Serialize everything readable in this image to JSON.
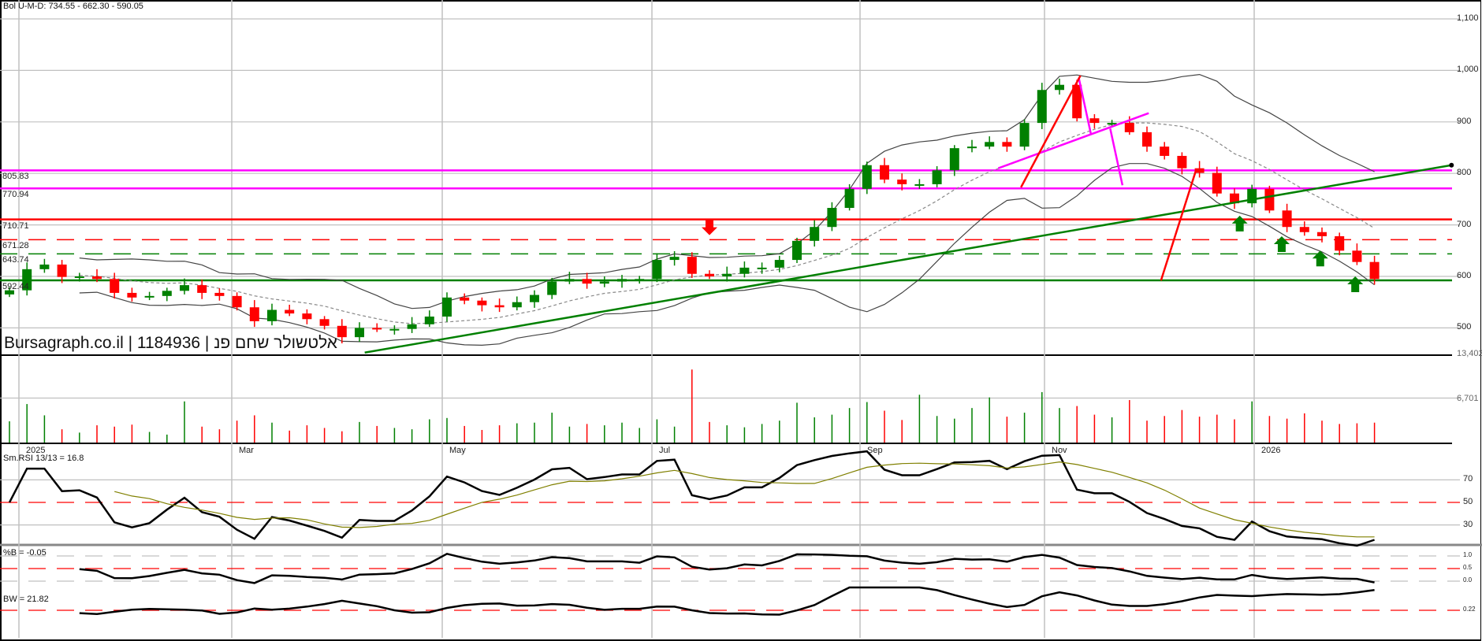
{
  "header": {
    "bollinger_readout": "Bol U-M-D: 734.55 - 662.30 - 590.05",
    "watermark": "Bursagraph.co.il | 1184936 | אלטשולר שחם פנ"
  },
  "indicators": {
    "rsi_label": "Sm.RSI 13/13 = 16.8",
    "pctb_label": "%B = -0.05",
    "bw_label": "BW = 21.82"
  },
  "colors": {
    "up": "#008000",
    "down": "#ff0000",
    "magenta": "#ff00ff",
    "band": "#444444",
    "grid": "#c0c0c0"
  },
  "chart_data": {
    "type": "candlestick",
    "title": "Bursagraph.co.il | 1184936 | אלטשולר שחם פנ",
    "x_tick_labels": [
      "2025",
      "Mar",
      "May",
      "Jul",
      "Sep",
      "Nov",
      "2026"
    ],
    "price_ticks": [
      {
        "value": 1100,
        "label": "1,100"
      },
      {
        "value": 1000,
        "label": "1,000"
      },
      {
        "value": 900,
        "label": "900"
      },
      {
        "value": 800,
        "label": "800"
      },
      {
        "value": 700,
        "label": "700"
      },
      {
        "value": 600,
        "label": "600"
      },
      {
        "value": 500,
        "label": "500"
      }
    ],
    "ylim": [
      430,
      1135
    ],
    "closes": [
      573,
      614,
      623,
      599,
      600,
      595,
      568,
      559,
      562,
      572,
      583,
      568,
      562,
      540,
      513,
      535,
      528,
      517,
      504,
      482,
      500,
      498,
      498,
      507,
      522,
      559,
      553,
      544,
      540,
      550,
      564,
      590,
      595,
      586,
      590,
      595,
      595,
      632,
      638,
      605,
      600,
      605,
      617,
      617,
      632,
      669,
      696,
      733,
      770,
      816,
      788,
      779,
      779,
      806,
      849,
      852,
      861,
      852,
      898,
      962,
      972,
      907,
      898,
      898,
      880,
      852,
      834,
      810,
      801,
      761,
      742,
      770,
      728,
      696,
      686,
      678,
      650,
      628,
      595
    ],
    "volume": [
      3200,
      5800,
      4100,
      2000,
      1500,
      2600,
      2400,
      2700,
      1600,
      1200,
      6200,
      2400,
      2000,
      3300,
      4100,
      3000,
      1800,
      2600,
      2200,
      1700,
      3100,
      2500,
      2200,
      2000,
      3500,
      3700,
      2500,
      1900,
      2600,
      2900,
      3000,
      4500,
      2400,
      2800,
      2600,
      3000,
      2200,
      3500,
      2400,
      11000,
      3100,
      2600,
      2300,
      2800,
      3300,
      6000,
      3800,
      4200,
      5200,
      6100,
      4800,
      3400,
      7200,
      4000,
      3600,
      5200,
      6800,
      3900,
      4500,
      7600,
      5200,
      5500,
      4200,
      3800,
      6400,
      3300,
      4000,
      4900,
      3900,
      4200,
      3500,
      6200,
      4000,
      3600,
      4400,
      3300,
      2800,
      2900,
      3000
    ],
    "volume_ticks": [
      {
        "value": 13402,
        "label": "13,402"
      },
      {
        "value": 6701,
        "label": "6,701"
      }
    ],
    "levels": [
      {
        "price": 805.83,
        "label": "805.83",
        "color": "#ff00ff",
        "style": "solid"
      },
      {
        "price": 770.94,
        "label": "770.94",
        "color": "#ff00ff",
        "style": "solid"
      },
      {
        "price": 710.71,
        "label": "710.71",
        "color": "#ff0000",
        "style": "solid"
      },
      {
        "price": 671.28,
        "label": "671.28",
        "color": "#ff0000",
        "style": "dashed"
      },
      {
        "price": 643.74,
        "label": "643.74",
        "color": "#008000",
        "style": "dashed"
      },
      {
        "price": 592.44,
        "label": "592.44",
        "color": "#008000",
        "style": "solid"
      }
    ],
    "trendlines": [
      {
        "name": "green-uptrend",
        "from": [
          20.3,
          452
        ],
        "to": [
          82.4,
          816
        ],
        "color": "#008000"
      },
      {
        "name": "magenta-neckline",
        "from": [
          56.5,
          810
        ],
        "to": [
          65.1,
          917
        ],
        "color": "#ff00ff"
      },
      {
        "name": "magenta-drop-1",
        "from": [
          61.1,
          986
        ],
        "to": [
          61.8,
          876
        ],
        "color": "#ff00ff"
      },
      {
        "name": "magenta-drop-2",
        "from": [
          62.9,
          887
        ],
        "to": [
          63.6,
          777
        ],
        "color": "#ff00ff"
      },
      {
        "name": "red-rise-1",
        "from": [
          57.8,
          773
        ],
        "to": [
          61.2,
          990
        ],
        "color": "#ff0000"
      },
      {
        "name": "red-rise-2",
        "from": [
          65.8,
          592
        ],
        "to": [
          67.8,
          806
        ],
        "color": "#ff0000"
      }
    ],
    "arrows": [
      {
        "index": 40,
        "price": 680,
        "dir": "down",
        "color": "#ff0000"
      },
      {
        "index": 70.3,
        "price": 718,
        "dir": "up",
        "color": "#008000"
      },
      {
        "index": 72.7,
        "price": 678,
        "dir": "up",
        "color": "#008000"
      },
      {
        "index": 74.9,
        "price": 650,
        "dir": "up",
        "color": "#008000"
      },
      {
        "index": 76.9,
        "price": 600,
        "dir": "up",
        "color": "#008000"
      }
    ],
    "rsi_ticks": [
      {
        "value": 70,
        "label": "70"
      },
      {
        "value": 50,
        "label": "50"
      },
      {
        "value": 30,
        "label": "30"
      }
    ],
    "pctb_ticks": [
      {
        "value": 1.0,
        "label": "1.0"
      },
      {
        "value": 0.5,
        "label": "0.5"
      },
      {
        "value": 0.0,
        "label": "0.0"
      }
    ],
    "bw_ticks": [
      {
        "value": 0.22,
        "label": "0.22"
      }
    ],
    "last_values": {
      "rsi": 16.8,
      "pctb": -0.05,
      "bw": 21.82
    }
  }
}
